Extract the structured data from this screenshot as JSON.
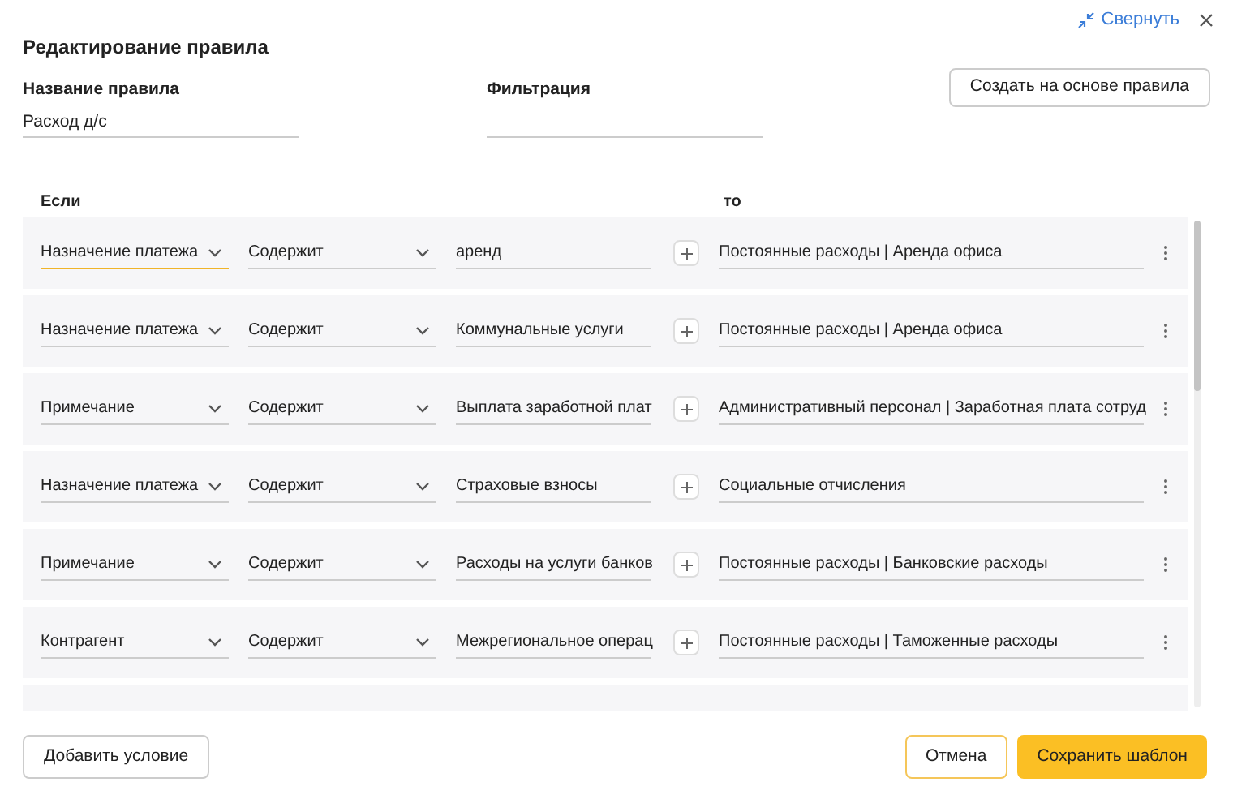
{
  "header": {
    "collapse_link": "Свернуть",
    "title": "Редактирование правила"
  },
  "rule_name": {
    "label": "Название правила",
    "value": "Расход д/с"
  },
  "filter": {
    "label": "Фильтрация"
  },
  "create_from_rule_button": "Создать на основе правила",
  "columns": {
    "if": "Если",
    "then": "то"
  },
  "rules": [
    {
      "field": "Назначение платежа",
      "field_focused": true,
      "operator": "Содержит",
      "value": "аренд",
      "target": "Постоянные расходы | Аренда офиса"
    },
    {
      "field": "Назначение платежа",
      "field_focused": false,
      "operator": "Содержит",
      "value": "Коммунальные услуги",
      "target": "Постоянные расходы | Аренда офиса"
    },
    {
      "field": "Примечание",
      "field_focused": false,
      "operator": "Содержит",
      "value": "Выплата заработной плат",
      "target": "Административный персонал | Заработная плата сотруд"
    },
    {
      "field": "Назначение платежа",
      "field_focused": false,
      "operator": "Содержит",
      "value": "Страховые взносы",
      "target": "Социальные отчисления"
    },
    {
      "field": "Примечание",
      "field_focused": false,
      "operator": "Содержит",
      "value": "Расходы на услуги банков",
      "target": "Постоянные расходы | Банковские расходы"
    },
    {
      "field": "Контрагент",
      "field_focused": false,
      "operator": "Содержит",
      "value": "Межрегиональное операц",
      "target": "Постоянные расходы | Таможенные расходы"
    }
  ],
  "footer": {
    "add_condition_button": "Добавить условие",
    "cancel_button": "Отмена",
    "save_button": "Сохранить шаблон"
  }
}
